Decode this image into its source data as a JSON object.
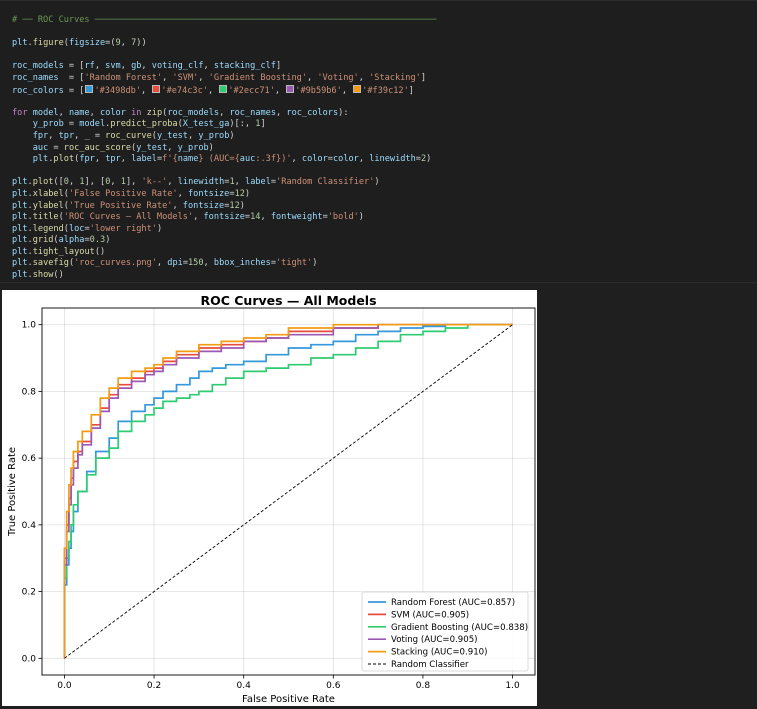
{
  "code": {
    "lines": [
      [
        [
          "c",
          "# ── ROC Curves ──────────────────────────────────────────────────────────────────"
        ]
      ],
      [],
      [
        [
          "v",
          "plt"
        ],
        [
          "p",
          "."
        ],
        [
          "f",
          "figure"
        ],
        [
          "p",
          "("
        ],
        [
          "v",
          "figsize"
        ],
        [
          "p",
          "=("
        ],
        [
          "n",
          "9"
        ],
        [
          "p",
          ", "
        ],
        [
          "n",
          "7"
        ],
        [
          "p",
          "))"
        ]
      ],
      [],
      [
        [
          "v",
          "roc_models"
        ],
        [
          "p",
          " = ["
        ],
        [
          "v",
          "rf"
        ],
        [
          "p",
          ", "
        ],
        [
          "v",
          "svm"
        ],
        [
          "p",
          ", "
        ],
        [
          "v",
          "gb"
        ],
        [
          "p",
          ", "
        ],
        [
          "v",
          "voting_clf"
        ],
        [
          "p",
          ", "
        ],
        [
          "v",
          "stacking_clf"
        ],
        [
          "p",
          "]"
        ]
      ],
      [
        [
          "v",
          "roc_names"
        ],
        [
          "p",
          "  = ["
        ],
        [
          "s",
          "'Random Forest'"
        ],
        [
          "p",
          ", "
        ],
        [
          "s",
          "'SVM'"
        ],
        [
          "p",
          ", "
        ],
        [
          "s",
          "'Gradient Boosting'"
        ],
        [
          "p",
          ", "
        ],
        [
          "s",
          "'Voting'"
        ],
        [
          "p",
          ", "
        ],
        [
          "s",
          "'Stacking'"
        ],
        [
          "p",
          "]"
        ]
      ],
      [
        [
          "v",
          "roc_colors"
        ],
        [
          "p",
          " = ["
        ],
        [
          "sw",
          "#3498db"
        ],
        [
          "s",
          "'#3498db'"
        ],
        [
          "p",
          ", "
        ],
        [
          "sw",
          "#e74c3c"
        ],
        [
          "s",
          "'#e74c3c'"
        ],
        [
          "p",
          ", "
        ],
        [
          "sw",
          "#2ecc71"
        ],
        [
          "s",
          "'#2ecc71'"
        ],
        [
          "p",
          ", "
        ],
        [
          "sw",
          "#9b59b6"
        ],
        [
          "s",
          "'#9b59b6'"
        ],
        [
          "p",
          ", "
        ],
        [
          "sw",
          "#f39c12"
        ],
        [
          "s",
          "'#f39c12'"
        ],
        [
          "p",
          "]"
        ]
      ],
      [],
      [
        [
          "k",
          "for"
        ],
        [
          "p",
          " "
        ],
        [
          "v",
          "model"
        ],
        [
          "p",
          ", "
        ],
        [
          "v",
          "name"
        ],
        [
          "p",
          ", "
        ],
        [
          "v",
          "color"
        ],
        [
          "p",
          " "
        ],
        [
          "k",
          "in"
        ],
        [
          "p",
          " "
        ],
        [
          "f",
          "zip"
        ],
        [
          "p",
          "("
        ],
        [
          "v",
          "roc_models"
        ],
        [
          "p",
          ", "
        ],
        [
          "v",
          "roc_names"
        ],
        [
          "p",
          ", "
        ],
        [
          "v",
          "roc_colors"
        ],
        [
          "p",
          "):"
        ]
      ],
      [
        [
          "p",
          "    "
        ],
        [
          "v",
          "y_prob"
        ],
        [
          "p",
          " = "
        ],
        [
          "v",
          "model"
        ],
        [
          "p",
          "."
        ],
        [
          "f",
          "predict_proba"
        ],
        [
          "p",
          "("
        ],
        [
          "v",
          "X_test_ga"
        ],
        [
          "p",
          ")[:, "
        ],
        [
          "n",
          "1"
        ],
        [
          "p",
          "]"
        ]
      ],
      [
        [
          "p",
          "    "
        ],
        [
          "v",
          "fpr"
        ],
        [
          "p",
          ", "
        ],
        [
          "v",
          "tpr"
        ],
        [
          "p",
          ", _ = "
        ],
        [
          "f",
          "roc_curve"
        ],
        [
          "p",
          "("
        ],
        [
          "v",
          "y_test"
        ],
        [
          "p",
          ", "
        ],
        [
          "v",
          "y_prob"
        ],
        [
          "p",
          ")"
        ]
      ],
      [
        [
          "p",
          "    "
        ],
        [
          "v",
          "auc"
        ],
        [
          "p",
          " = "
        ],
        [
          "f",
          "roc_auc_score"
        ],
        [
          "p",
          "("
        ],
        [
          "v",
          "y_test"
        ],
        [
          "p",
          ", "
        ],
        [
          "v",
          "y_prob"
        ],
        [
          "p",
          ")"
        ]
      ],
      [
        [
          "p",
          "    "
        ],
        [
          "v",
          "plt"
        ],
        [
          "p",
          "."
        ],
        [
          "f",
          "plot"
        ],
        [
          "p",
          "("
        ],
        [
          "v",
          "fpr"
        ],
        [
          "p",
          ", "
        ],
        [
          "v",
          "tpr"
        ],
        [
          "p",
          ", "
        ],
        [
          "v",
          "label"
        ],
        [
          "p",
          "="
        ],
        [
          "s",
          "f'{"
        ],
        [
          "v",
          "name"
        ],
        [
          "s",
          "} (AUC={"
        ],
        [
          "v",
          "auc"
        ],
        [
          "s",
          ":.3f})'"
        ],
        [
          "p",
          ", "
        ],
        [
          "v",
          "color"
        ],
        [
          "p",
          "="
        ],
        [
          "v",
          "color"
        ],
        [
          "p",
          ", "
        ],
        [
          "v",
          "linewidth"
        ],
        [
          "p",
          "="
        ],
        [
          "n",
          "2"
        ],
        [
          "p",
          ")"
        ]
      ],
      [],
      [
        [
          "v",
          "plt"
        ],
        [
          "p",
          "."
        ],
        [
          "f",
          "plot"
        ],
        [
          "p",
          "(["
        ],
        [
          "n",
          "0"
        ],
        [
          "p",
          ", "
        ],
        [
          "n",
          "1"
        ],
        [
          "p",
          "], ["
        ],
        [
          "n",
          "0"
        ],
        [
          "p",
          ", "
        ],
        [
          "n",
          "1"
        ],
        [
          "p",
          "], "
        ],
        [
          "s",
          "'k--'"
        ],
        [
          "p",
          ", "
        ],
        [
          "v",
          "linewidth"
        ],
        [
          "p",
          "="
        ],
        [
          "n",
          "1"
        ],
        [
          "p",
          ", "
        ],
        [
          "v",
          "label"
        ],
        [
          "p",
          "="
        ],
        [
          "s",
          "'Random Classifier'"
        ],
        [
          "p",
          ")"
        ]
      ],
      [
        [
          "v",
          "plt"
        ],
        [
          "p",
          "."
        ],
        [
          "f",
          "xlabel"
        ],
        [
          "p",
          "("
        ],
        [
          "s",
          "'False Positive Rate'"
        ],
        [
          "p",
          ", "
        ],
        [
          "v",
          "fontsize"
        ],
        [
          "p",
          "="
        ],
        [
          "n",
          "12"
        ],
        [
          "p",
          ")"
        ]
      ],
      [
        [
          "v",
          "plt"
        ],
        [
          "p",
          "."
        ],
        [
          "f",
          "ylabel"
        ],
        [
          "p",
          "("
        ],
        [
          "s",
          "'True Positive Rate'"
        ],
        [
          "p",
          ", "
        ],
        [
          "v",
          "fontsize"
        ],
        [
          "p",
          "="
        ],
        [
          "n",
          "12"
        ],
        [
          "p",
          ")"
        ]
      ],
      [
        [
          "v",
          "plt"
        ],
        [
          "p",
          "."
        ],
        [
          "f",
          "title"
        ],
        [
          "p",
          "("
        ],
        [
          "s",
          "'ROC Curves — All Models'"
        ],
        [
          "p",
          ", "
        ],
        [
          "v",
          "fontsize"
        ],
        [
          "p",
          "="
        ],
        [
          "n",
          "14"
        ],
        [
          "p",
          ", "
        ],
        [
          "v",
          "fontweight"
        ],
        [
          "p",
          "="
        ],
        [
          "s",
          "'bold'"
        ],
        [
          "p",
          ")"
        ]
      ],
      [
        [
          "v",
          "plt"
        ],
        [
          "p",
          "."
        ],
        [
          "f",
          "legend"
        ],
        [
          "p",
          "("
        ],
        [
          "v",
          "loc"
        ],
        [
          "p",
          "="
        ],
        [
          "s",
          "'lower right'"
        ],
        [
          "p",
          ")"
        ]
      ],
      [
        [
          "v",
          "plt"
        ],
        [
          "p",
          "."
        ],
        [
          "f",
          "grid"
        ],
        [
          "p",
          "("
        ],
        [
          "v",
          "alpha"
        ],
        [
          "p",
          "="
        ],
        [
          "n",
          "0.3"
        ],
        [
          "p",
          ")"
        ]
      ],
      [
        [
          "v",
          "plt"
        ],
        [
          "p",
          "."
        ],
        [
          "f",
          "tight_layout"
        ],
        [
          "p",
          "()"
        ]
      ],
      [
        [
          "v",
          "plt"
        ],
        [
          "p",
          "."
        ],
        [
          "f",
          "savefig"
        ],
        [
          "p",
          "("
        ],
        [
          "s",
          "'roc_curves.png'"
        ],
        [
          "p",
          ", "
        ],
        [
          "v",
          "dpi"
        ],
        [
          "p",
          "="
        ],
        [
          "n",
          "150"
        ],
        [
          "p",
          ", "
        ],
        [
          "v",
          "bbox_inches"
        ],
        [
          "p",
          "="
        ],
        [
          "s",
          "'tight'"
        ],
        [
          "p",
          ")"
        ]
      ],
      [
        [
          "v",
          "plt"
        ],
        [
          "p",
          "."
        ],
        [
          "f",
          "show"
        ],
        [
          "p",
          "()"
        ]
      ]
    ]
  },
  "chart_data": {
    "type": "line",
    "title": "ROC Curves — All Models",
    "xlabel": "False Positive Rate",
    "ylabel": "True Positive Rate",
    "xlim": [
      -0.05,
      1.05
    ],
    "ylim": [
      -0.05,
      1.05
    ],
    "xticks": [
      "0.0",
      "0.2",
      "0.4",
      "0.6",
      "0.8",
      "1.0"
    ],
    "yticks": [
      "0.0",
      "0.2",
      "0.4",
      "0.6",
      "0.8",
      "1.0"
    ],
    "grid": true,
    "legend_position": "lower right",
    "series": [
      {
        "name": "Random Forest (AUC=0.857)",
        "color": "#3498db",
        "style": "solid",
        "x": [
          0,
          0,
          0.005,
          0.01,
          0.015,
          0.02,
          0.03,
          0.05,
          0.07,
          0.1,
          0.12,
          0.15,
          0.18,
          0.2,
          0.22,
          0.25,
          0.28,
          0.3,
          0.33,
          0.36,
          0.4,
          0.45,
          0.5,
          0.55,
          0.6,
          0.65,
          0.7,
          0.75,
          0.8,
          0.85,
          0.9,
          0.95,
          1.0
        ],
        "y": [
          0,
          0.12,
          0.22,
          0.28,
          0.33,
          0.38,
          0.44,
          0.5,
          0.56,
          0.62,
          0.66,
          0.71,
          0.74,
          0.76,
          0.78,
          0.8,
          0.82,
          0.84,
          0.86,
          0.87,
          0.88,
          0.89,
          0.91,
          0.93,
          0.94,
          0.95,
          0.97,
          0.98,
          0.99,
          0.995,
          1.0,
          1.0,
          1.0
        ]
      },
      {
        "name": "SVM (AUC=0.905)",
        "color": "#e74c3c",
        "style": "solid",
        "x": [
          0,
          0,
          0.005,
          0.01,
          0.015,
          0.02,
          0.03,
          0.04,
          0.06,
          0.08,
          0.1,
          0.12,
          0.15,
          0.18,
          0.2,
          0.22,
          0.25,
          0.3,
          0.35,
          0.4,
          0.45,
          0.5,
          0.6,
          0.7,
          0.75,
          0.8,
          0.9,
          1.0
        ],
        "y": [
          0,
          0.18,
          0.3,
          0.4,
          0.48,
          0.54,
          0.59,
          0.62,
          0.65,
          0.7,
          0.75,
          0.79,
          0.82,
          0.84,
          0.86,
          0.87,
          0.89,
          0.91,
          0.93,
          0.94,
          0.95,
          0.96,
          0.98,
          0.99,
          1.0,
          1.0,
          1.0,
          1.0
        ]
      },
      {
        "name": "Gradient Boosting (AUC=0.838)",
        "color": "#2ecc71",
        "style": "solid",
        "x": [
          0,
          0,
          0.005,
          0.01,
          0.015,
          0.02,
          0.03,
          0.05,
          0.07,
          0.1,
          0.12,
          0.15,
          0.18,
          0.2,
          0.22,
          0.25,
          0.28,
          0.3,
          0.33,
          0.36,
          0.4,
          0.45,
          0.5,
          0.55,
          0.6,
          0.65,
          0.7,
          0.75,
          0.8,
          0.85,
          0.9,
          0.95,
          1.0
        ],
        "y": [
          0,
          0.15,
          0.24,
          0.3,
          0.35,
          0.4,
          0.46,
          0.5,
          0.55,
          0.6,
          0.63,
          0.68,
          0.71,
          0.73,
          0.75,
          0.77,
          0.78,
          0.79,
          0.8,
          0.82,
          0.84,
          0.86,
          0.87,
          0.88,
          0.9,
          0.91,
          0.93,
          0.95,
          0.97,
          0.98,
          0.99,
          1.0,
          1.0
        ]
      },
      {
        "name": "Voting (AUC=0.905)",
        "color": "#9b59b6",
        "style": "solid",
        "x": [
          0,
          0,
          0.005,
          0.01,
          0.015,
          0.02,
          0.03,
          0.04,
          0.06,
          0.08,
          0.1,
          0.12,
          0.15,
          0.18,
          0.2,
          0.22,
          0.25,
          0.3,
          0.35,
          0.4,
          0.45,
          0.5,
          0.6,
          0.7,
          0.75,
          0.8,
          0.9,
          1.0
        ],
        "y": [
          0,
          0.16,
          0.28,
          0.38,
          0.46,
          0.52,
          0.57,
          0.61,
          0.64,
          0.69,
          0.74,
          0.78,
          0.81,
          0.83,
          0.85,
          0.86,
          0.88,
          0.9,
          0.92,
          0.93,
          0.95,
          0.96,
          0.97,
          0.99,
          1.0,
          1.0,
          1.0,
          1.0
        ]
      },
      {
        "name": "Stacking (AUC=0.910)",
        "color": "#f39c12",
        "style": "solid",
        "x": [
          0,
          0,
          0.005,
          0.01,
          0.015,
          0.02,
          0.03,
          0.04,
          0.06,
          0.08,
          0.1,
          0.12,
          0.15,
          0.18,
          0.2,
          0.22,
          0.25,
          0.3,
          0.35,
          0.4,
          0.45,
          0.5,
          0.6,
          0.7,
          0.75,
          0.8,
          0.9,
          1.0
        ],
        "y": [
          0,
          0.2,
          0.33,
          0.44,
          0.52,
          0.57,
          0.62,
          0.65,
          0.68,
          0.73,
          0.78,
          0.81,
          0.84,
          0.86,
          0.87,
          0.88,
          0.9,
          0.92,
          0.94,
          0.95,
          0.96,
          0.97,
          0.99,
          1.0,
          1.0,
          1.0,
          1.0,
          1.0
        ]
      },
      {
        "name": "Random Classifier",
        "color": "#000000",
        "style": "dashed",
        "x": [
          0,
          1
        ],
        "y": [
          0,
          1
        ]
      }
    ]
  }
}
